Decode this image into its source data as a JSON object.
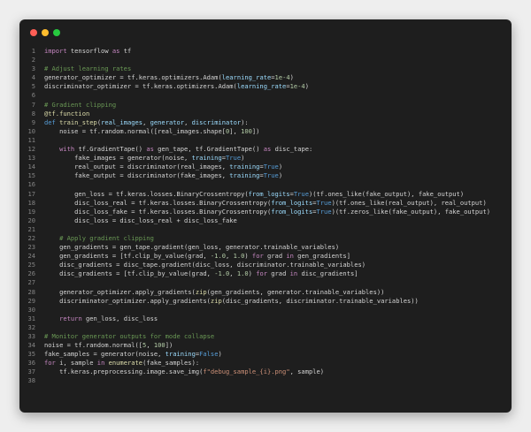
{
  "window": {
    "controls": {
      "close_color": "#ff5f56",
      "minimize_color": "#ffbd2e",
      "maximize_color": "#27c93f"
    }
  },
  "editor": {
    "language": "python",
    "lines": [
      [
        {
          "t": "import",
          "c": "ctl"
        },
        {
          "t": " tensorflow ",
          "c": "src"
        },
        {
          "t": "as",
          "c": "ctl"
        },
        {
          "t": " tf",
          "c": "src"
        }
      ],
      [],
      [
        {
          "t": "# Adjust learning rates",
          "c": "cm"
        }
      ],
      [
        {
          "t": "generator_optimizer = tf.keras.optimizers.Adam(",
          "c": "src"
        },
        {
          "t": "learning_rate",
          "c": "par"
        },
        {
          "t": "=",
          "c": "src"
        },
        {
          "t": "1e-4",
          "c": "num"
        },
        {
          "t": ")",
          "c": "src"
        }
      ],
      [
        {
          "t": "discriminator_optimizer = tf.keras.optimizers.Adam(",
          "c": "src"
        },
        {
          "t": "learning_rate",
          "c": "par"
        },
        {
          "t": "=",
          "c": "src"
        },
        {
          "t": "1e-4",
          "c": "num"
        },
        {
          "t": ")",
          "c": "src"
        }
      ],
      [],
      [
        {
          "t": "# Gradient clipping",
          "c": "cm"
        }
      ],
      [
        {
          "t": "@tf.function",
          "c": "dec"
        }
      ],
      [
        {
          "t": "def",
          "c": "kw"
        },
        {
          "t": " ",
          "c": "src"
        },
        {
          "t": "train_step",
          "c": "fn"
        },
        {
          "t": "(",
          "c": "src"
        },
        {
          "t": "real_images",
          "c": "par"
        },
        {
          "t": ", ",
          "c": "src"
        },
        {
          "t": "generator",
          "c": "par"
        },
        {
          "t": ", ",
          "c": "src"
        },
        {
          "t": "discriminator",
          "c": "par"
        },
        {
          "t": "):",
          "c": "src"
        }
      ],
      [
        {
          "t": "    noise = tf.random.normal([real_images.shape[",
          "c": "src"
        },
        {
          "t": "0",
          "c": "num"
        },
        {
          "t": "], ",
          "c": "src"
        },
        {
          "t": "100",
          "c": "num"
        },
        {
          "t": "])",
          "c": "src"
        }
      ],
      [],
      [
        {
          "t": "    ",
          "c": "src"
        },
        {
          "t": "with",
          "c": "ctl"
        },
        {
          "t": " tf.GradientTape() ",
          "c": "src"
        },
        {
          "t": "as",
          "c": "ctl"
        },
        {
          "t": " gen_tape, tf.GradientTape() ",
          "c": "src"
        },
        {
          "t": "as",
          "c": "ctl"
        },
        {
          "t": " disc_tape:",
          "c": "src"
        }
      ],
      [
        {
          "t": "        fake_images = generator(noise, ",
          "c": "src"
        },
        {
          "t": "training",
          "c": "par"
        },
        {
          "t": "=",
          "c": "src"
        },
        {
          "t": "True",
          "c": "kw"
        },
        {
          "t": ")",
          "c": "src"
        }
      ],
      [
        {
          "t": "        real_output = discriminator(real_images, ",
          "c": "src"
        },
        {
          "t": "training",
          "c": "par"
        },
        {
          "t": "=",
          "c": "src"
        },
        {
          "t": "True",
          "c": "kw"
        },
        {
          "t": ")",
          "c": "src"
        }
      ],
      [
        {
          "t": "        fake_output = discriminator(fake_images, ",
          "c": "src"
        },
        {
          "t": "training",
          "c": "par"
        },
        {
          "t": "=",
          "c": "src"
        },
        {
          "t": "True",
          "c": "kw"
        },
        {
          "t": ")",
          "c": "src"
        }
      ],
      [],
      [
        {
          "t": "        gen_loss = tf.keras.losses.BinaryCrossentropy(",
          "c": "src"
        },
        {
          "t": "from_logits",
          "c": "par"
        },
        {
          "t": "=",
          "c": "src"
        },
        {
          "t": "True",
          "c": "kw"
        },
        {
          "t": ")(tf.ones_like(fake_output), fake_output)",
          "c": "src"
        }
      ],
      [
        {
          "t": "        disc_loss_real = tf.keras.losses.BinaryCrossentropy(",
          "c": "src"
        },
        {
          "t": "from_logits",
          "c": "par"
        },
        {
          "t": "=",
          "c": "src"
        },
        {
          "t": "True",
          "c": "kw"
        },
        {
          "t": ")(tf.ones_like(real_output), real_output)",
          "c": "src"
        }
      ],
      [
        {
          "t": "        disc_loss_fake = tf.keras.losses.BinaryCrossentropy(",
          "c": "src"
        },
        {
          "t": "from_logits",
          "c": "par"
        },
        {
          "t": "=",
          "c": "src"
        },
        {
          "t": "True",
          "c": "kw"
        },
        {
          "t": ")(tf.zeros_like(fake_output), fake_output)",
          "c": "src"
        }
      ],
      [
        {
          "t": "        disc_loss = disc_loss_real + disc_loss_fake",
          "c": "src"
        }
      ],
      [],
      [
        {
          "t": "    # Apply gradient clipping",
          "c": "cm"
        }
      ],
      [
        {
          "t": "    gen_gradients = gen_tape.gradient(gen_loss, generator.trainable_variables)",
          "c": "src"
        }
      ],
      [
        {
          "t": "    gen_gradients = [tf.clip_by_value(grad, ",
          "c": "src"
        },
        {
          "t": "-1.0",
          "c": "num"
        },
        {
          "t": ", ",
          "c": "src"
        },
        {
          "t": "1.0",
          "c": "num"
        },
        {
          "t": ") ",
          "c": "src"
        },
        {
          "t": "for",
          "c": "ctl"
        },
        {
          "t": " grad ",
          "c": "src"
        },
        {
          "t": "in",
          "c": "ctl"
        },
        {
          "t": " gen_gradients]",
          "c": "src"
        }
      ],
      [
        {
          "t": "    disc_gradients = disc_tape.gradient(disc_loss, discriminator.trainable_variables)",
          "c": "src"
        }
      ],
      [
        {
          "t": "    disc_gradients = [tf.clip_by_value(grad, ",
          "c": "src"
        },
        {
          "t": "-1.0",
          "c": "num"
        },
        {
          "t": ", ",
          "c": "src"
        },
        {
          "t": "1.0",
          "c": "num"
        },
        {
          "t": ") ",
          "c": "src"
        },
        {
          "t": "for",
          "c": "ctl"
        },
        {
          "t": " grad ",
          "c": "src"
        },
        {
          "t": "in",
          "c": "ctl"
        },
        {
          "t": " disc_gradients]",
          "c": "src"
        }
      ],
      [],
      [
        {
          "t": "    generator_optimizer.apply_gradients(",
          "c": "src"
        },
        {
          "t": "zip",
          "c": "fn"
        },
        {
          "t": "(gen_gradients, generator.trainable_variables))",
          "c": "src"
        }
      ],
      [
        {
          "t": "    discriminator_optimizer.apply_gradients(",
          "c": "src"
        },
        {
          "t": "zip",
          "c": "fn"
        },
        {
          "t": "(disc_gradients, discriminator.trainable_variables))",
          "c": "src"
        }
      ],
      [],
      [
        {
          "t": "    ",
          "c": "src"
        },
        {
          "t": "return",
          "c": "ctl"
        },
        {
          "t": " gen_loss, disc_loss",
          "c": "src"
        }
      ],
      [],
      [
        {
          "t": "# Monitor generator outputs for mode collapse",
          "c": "cm"
        }
      ],
      [
        {
          "t": "noise = tf.random.normal([",
          "c": "src"
        },
        {
          "t": "5",
          "c": "num"
        },
        {
          "t": ", ",
          "c": "src"
        },
        {
          "t": "100",
          "c": "num"
        },
        {
          "t": "])",
          "c": "src"
        }
      ],
      [
        {
          "t": "fake_samples = generator(noise, ",
          "c": "src"
        },
        {
          "t": "training",
          "c": "par"
        },
        {
          "t": "=",
          "c": "src"
        },
        {
          "t": "False",
          "c": "kw"
        },
        {
          "t": ")",
          "c": "src"
        }
      ],
      [
        {
          "t": "for",
          "c": "ctl"
        },
        {
          "t": " i, sample ",
          "c": "src"
        },
        {
          "t": "in",
          "c": "ctl"
        },
        {
          "t": " ",
          "c": "src"
        },
        {
          "t": "enumerate",
          "c": "fn"
        },
        {
          "t": "(fake_samples):",
          "c": "src"
        }
      ],
      [
        {
          "t": "    tf.keras.preprocessing.image.save_img(",
          "c": "src"
        },
        {
          "t": "f\"debug_sample_{i}.png\"",
          "c": "str"
        },
        {
          "t": ", sample)",
          "c": "src"
        }
      ],
      []
    ]
  }
}
